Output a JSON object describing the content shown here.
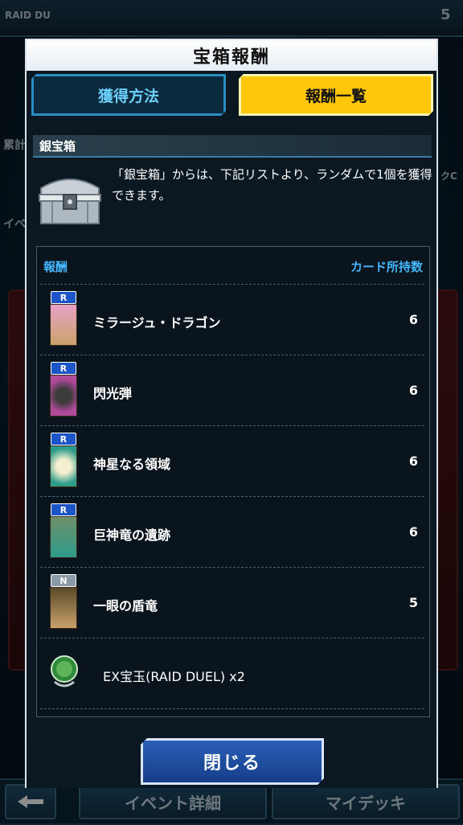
{
  "background": {
    "top_left_label": "RAID DU",
    "top_right_label": "5",
    "left_label_1": "累計",
    "left_label_2": "イベ",
    "right_label": "クC",
    "bottom_left_icon": "back-arrow-icon",
    "bottom_buttons": [
      "イベント詳細",
      "マイデッキ"
    ]
  },
  "dialog": {
    "title": "宝箱報酬",
    "tabs": [
      {
        "label": "獲得方法",
        "active": false
      },
      {
        "label": "報酬一覧",
        "active": true
      }
    ],
    "section_title": "銀宝箱",
    "description": "「銀宝箱」からは、下記リストより、ランダムで1個を獲得できます。",
    "chest_icon": "silver-chest-icon",
    "list": {
      "header_left": "報酬",
      "header_right": "カード所持数",
      "rows": [
        {
          "rarity": "R",
          "name": "ミラージュ・ドラゴン",
          "count": "6",
          "card_color": "#c9a26a"
        },
        {
          "rarity": "R",
          "name": "閃光弾",
          "count": "6",
          "card_color": "#b04a9a"
        },
        {
          "rarity": "R",
          "name": "神星なる領域",
          "count": "6",
          "card_color": "#2e9c8a"
        },
        {
          "rarity": "R",
          "name": "巨神竜の遺跡",
          "count": "6",
          "card_color": "#2e9c8a"
        },
        {
          "rarity": "N",
          "name": "一眼の盾竜",
          "count": "5",
          "card_color": "#c9a26a"
        },
        {
          "rarity": "",
          "name": "EX宝玉(RAID DUEL) x2",
          "count": "",
          "card_color": ""
        }
      ]
    },
    "close_label": "閉じる"
  },
  "colors": {
    "accent_blue": "#44b6ff",
    "tab_active": "#ffc70a",
    "rarity_r": "#1c55c8",
    "rarity_n": "#8b9aa6"
  }
}
